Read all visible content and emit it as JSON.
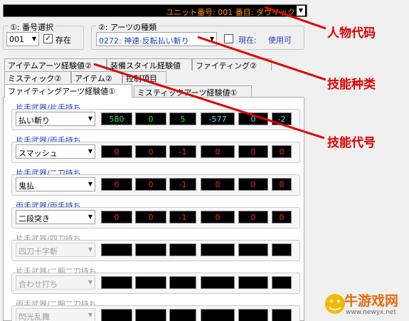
{
  "unit": {
    "text": "ユニット番号: 001 番目: ダウイック",
    "arrow": "▼"
  },
  "group1": {
    "label": "①: 番号選択",
    "number": "001",
    "exists_label": "存在",
    "exists_checked": true
  },
  "group2": {
    "label": "②: アーツの種類",
    "arts_value": "0272: 神速·反転払い斬り",
    "current_label": "現在:",
    "current_value": "使用可"
  },
  "tabs_row1": [
    "アイテムアーツ経験値②",
    "装備スタイル経験値",
    "ファイティング②"
  ],
  "tabs_row2": [
    "ミスティック②",
    "アイテム②",
    "控制項目"
  ],
  "tabs_row3": [
    "ファイティングアーツ経験値①",
    "ミスティックアーツ経験値①"
  ],
  "skill_rows": [
    {
      "category": "片手武器/片手持ち",
      "skill": "払い斬り",
      "enabled": true,
      "values": [
        {
          "text": "580",
          "color": "green"
        },
        {
          "text": "0",
          "color": "green"
        },
        {
          "text": "5",
          "color": "green"
        },
        {
          "text": "-577",
          "color": "cyan"
        },
        {
          "text": "0",
          "color": "cyan"
        },
        {
          "text": "-2",
          "color": "cyan"
        }
      ]
    },
    {
      "category": "片手武器/両手持ち",
      "skill": "スマッシュ",
      "enabled": true,
      "values": [
        {
          "text": "0",
          "color": "red"
        },
        {
          "text": "0",
          "color": "red"
        },
        {
          "text": "-1",
          "color": "red"
        },
        {
          "text": "0",
          "color": "red"
        },
        {
          "text": "0",
          "color": "red"
        },
        {
          "text": "0",
          "color": "red"
        }
      ]
    },
    {
      "category": "片手武器/二刀持ち",
      "skill": "鬼払",
      "enabled": true,
      "values": [
        {
          "text": "0",
          "color": "red"
        },
        {
          "text": "0",
          "color": "red"
        },
        {
          "text": "-1",
          "color": "red"
        },
        {
          "text": "0",
          "color": "red"
        },
        {
          "text": "0",
          "color": "red"
        },
        {
          "text": "0",
          "color": "red"
        }
      ]
    },
    {
      "category": "両手武器/両手持ち",
      "skill": "二段突き",
      "enabled": true,
      "values": [
        {
          "text": "0",
          "color": "red"
        },
        {
          "text": "0",
          "color": "red"
        },
        {
          "text": "-1",
          "color": "red"
        },
        {
          "text": "0",
          "color": "red"
        },
        {
          "text": "0",
          "color": "red"
        },
        {
          "text": "0",
          "color": "red"
        }
      ]
    },
    {
      "category": "片手武器/四刀持ち",
      "skill": "四刀十字斬",
      "enabled": false,
      "values": [
        {
          "text": "",
          "color": "red"
        },
        {
          "text": "",
          "color": "red"
        },
        {
          "text": "",
          "color": "red"
        },
        {
          "text": "",
          "color": "red"
        },
        {
          "text": "",
          "color": "red"
        },
        {
          "text": "",
          "color": "red"
        }
      ]
    },
    {
      "category": "片手武器/二腕二刀持ち",
      "skill": "合わせ打ち",
      "enabled": false,
      "values": [
        {
          "text": "",
          "color": "red"
        },
        {
          "text": "",
          "color": "red"
        },
        {
          "text": "",
          "color": "red"
        },
        {
          "text": "",
          "color": "red"
        },
        {
          "text": "",
          "color": "red"
        },
        {
          "text": "",
          "color": "red"
        }
      ]
    },
    {
      "category": "両手武器/二腕二刀持ち",
      "skill": "閃光乱舞",
      "enabled": false,
      "values": [
        {
          "text": "",
          "color": "red"
        },
        {
          "text": "",
          "color": "red"
        },
        {
          "text": "",
          "color": "red"
        },
        {
          "text": "",
          "color": "red"
        },
        {
          "text": "",
          "color": "red"
        },
        {
          "text": "",
          "color": "red"
        }
      ]
    }
  ],
  "annotations": {
    "character_code": "人物代码",
    "skill_type": "技能种类",
    "skill_code": "技能代号",
    "color": "#e00000"
  },
  "watermark": {
    "text": "牛游戏网",
    "url": "www.newyx.net"
  }
}
